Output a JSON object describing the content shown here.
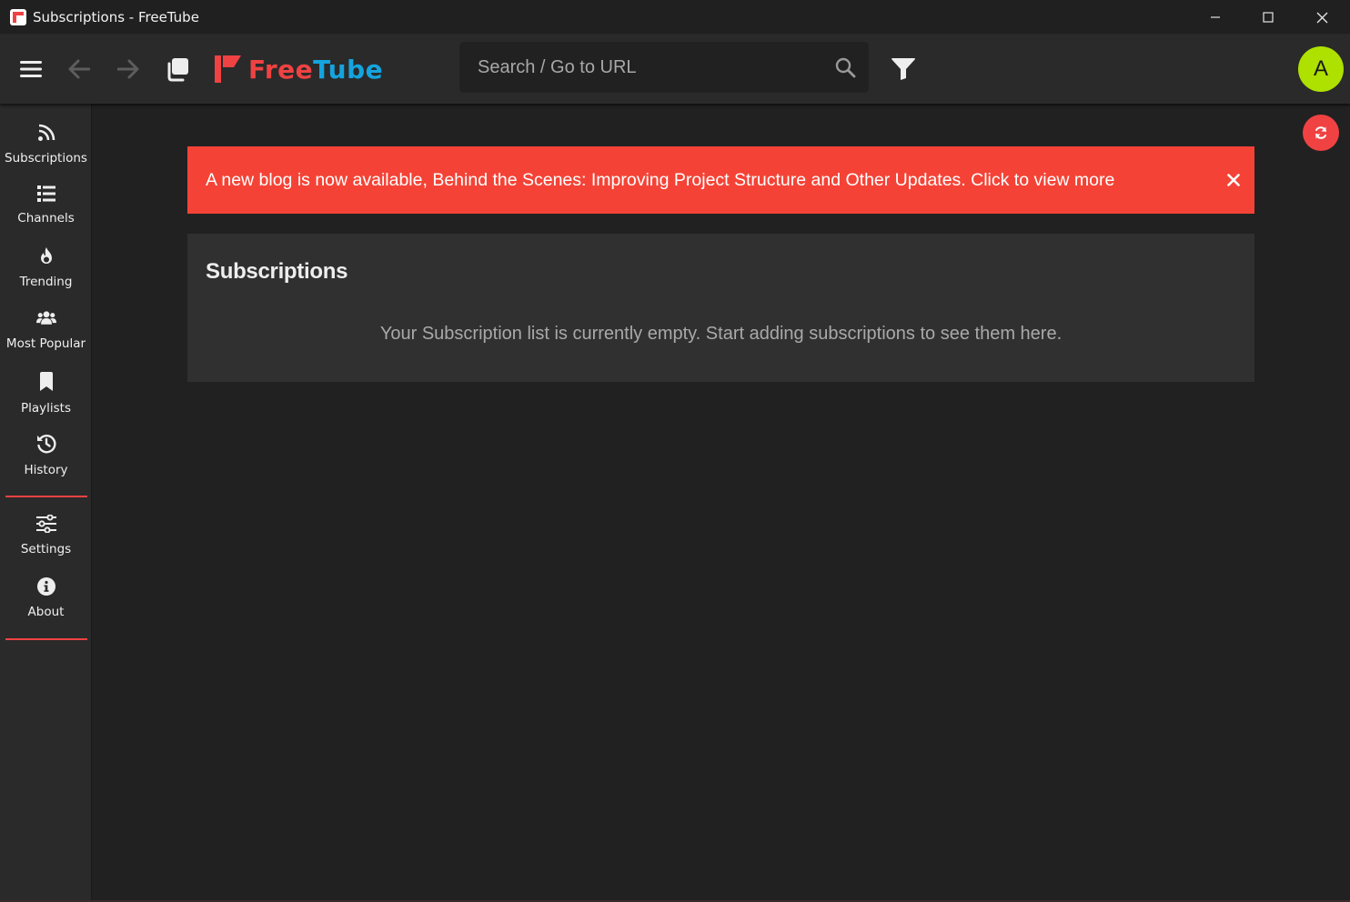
{
  "window": {
    "title": "Subscriptions - FreeTube"
  },
  "topnav": {
    "logo_free": "Free",
    "logo_tube": "Tube",
    "search_placeholder": "Search / Go to URL",
    "avatar_letter": "A"
  },
  "sidebar": {
    "items": [
      {
        "label": "Subscriptions",
        "icon": "rss-icon"
      },
      {
        "label": "Channels",
        "icon": "list-icon"
      },
      {
        "label": "Trending",
        "icon": "fire-icon"
      },
      {
        "label": "Most Popular",
        "icon": "users-icon"
      },
      {
        "label": "Playlists",
        "icon": "bookmark-icon"
      },
      {
        "label": "History",
        "icon": "history-icon"
      },
      {
        "label": "Settings",
        "icon": "sliders-icon"
      },
      {
        "label": "About",
        "icon": "info-icon"
      }
    ]
  },
  "banner": {
    "text": "A new blog is now available, Behind the Scenes: Improving Project Structure and Other Updates. Click to view more"
  },
  "main": {
    "title": "Subscriptions",
    "empty_message": "Your Subscription list is currently empty. Start adding subscriptions to see them here."
  },
  "colors": {
    "accent": "#f04242",
    "banner": "#f44336",
    "avatar": "#aee000",
    "logo_blue": "#14a4df",
    "background": "#212121",
    "panel": "#2a2a2a",
    "card": "#303030"
  }
}
